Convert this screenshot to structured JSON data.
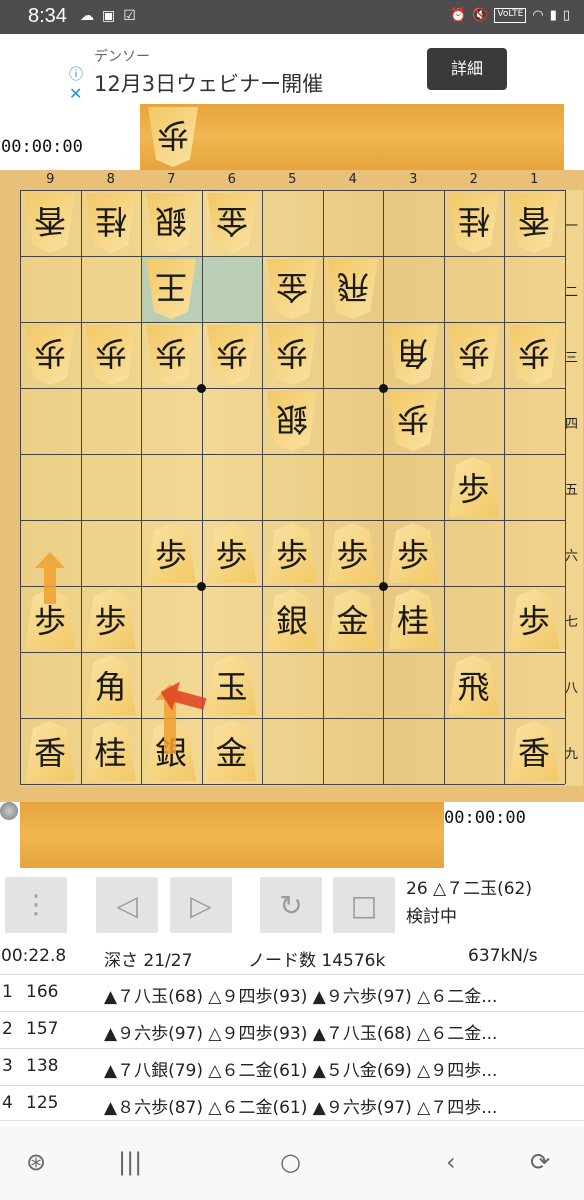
{
  "status_bar": {
    "time": "8:34",
    "left_icons": [
      "cloud-icon",
      "image-icon",
      "check-icon"
    ],
    "right_icons": [
      "alarm-icon",
      "mute-icon",
      "volte-icon",
      "wifi-icon",
      "signal-icon",
      "battery-icon"
    ],
    "volte": "VoLTE"
  },
  "ad": {
    "brand": "デンソー",
    "message": "12月3日ウェビナー開催",
    "cta": "詳細"
  },
  "clocks": {
    "gote": "00:00:00",
    "sente": "00:00:00"
  },
  "gote_hand": [
    "歩"
  ],
  "board": {
    "columns": [
      "9",
      "8",
      "7",
      "6",
      "5",
      "4",
      "3",
      "2",
      "1"
    ],
    "rows": [
      "一",
      "二",
      "三",
      "四",
      "五",
      "六",
      "七",
      "八",
      "九"
    ],
    "pieces": [
      {
        "c": 0,
        "r": 0,
        "k": "香",
        "g": true
      },
      {
        "c": 1,
        "r": 0,
        "k": "桂",
        "g": true
      },
      {
        "c": 2,
        "r": 0,
        "k": "銀",
        "g": true
      },
      {
        "c": 3,
        "r": 0,
        "k": "金",
        "g": true
      },
      {
        "c": 7,
        "r": 0,
        "k": "桂",
        "g": true
      },
      {
        "c": 8,
        "r": 0,
        "k": "香",
        "g": true
      },
      {
        "c": 2,
        "r": 1,
        "k": "王",
        "g": true
      },
      {
        "c": 4,
        "r": 1,
        "k": "金",
        "g": true
      },
      {
        "c": 5,
        "r": 1,
        "k": "飛",
        "g": true
      },
      {
        "c": 0,
        "r": 2,
        "k": "歩",
        "g": true
      },
      {
        "c": 1,
        "r": 2,
        "k": "歩",
        "g": true
      },
      {
        "c": 2,
        "r": 2,
        "k": "歩",
        "g": true
      },
      {
        "c": 3,
        "r": 2,
        "k": "歩",
        "g": true
      },
      {
        "c": 4,
        "r": 2,
        "k": "歩",
        "g": true
      },
      {
        "c": 6,
        "r": 2,
        "k": "角",
        "g": true
      },
      {
        "c": 7,
        "r": 2,
        "k": "歩",
        "g": true
      },
      {
        "c": 8,
        "r": 2,
        "k": "歩",
        "g": true
      },
      {
        "c": 4,
        "r": 3,
        "k": "銀",
        "g": true
      },
      {
        "c": 6,
        "r": 3,
        "k": "歩",
        "g": true
      },
      {
        "c": 7,
        "r": 4,
        "k": "歩",
        "g": false
      },
      {
        "c": 2,
        "r": 5,
        "k": "歩",
        "g": false
      },
      {
        "c": 3,
        "r": 5,
        "k": "歩",
        "g": false
      },
      {
        "c": 4,
        "r": 5,
        "k": "歩",
        "g": false
      },
      {
        "c": 5,
        "r": 5,
        "k": "歩",
        "g": false
      },
      {
        "c": 6,
        "r": 5,
        "k": "歩",
        "g": false
      },
      {
        "c": 0,
        "r": 6,
        "k": "歩",
        "g": false
      },
      {
        "c": 1,
        "r": 6,
        "k": "歩",
        "g": false
      },
      {
        "c": 4,
        "r": 6,
        "k": "銀",
        "g": false
      },
      {
        "c": 5,
        "r": 6,
        "k": "金",
        "g": false
      },
      {
        "c": 6,
        "r": 6,
        "k": "桂",
        "g": false
      },
      {
        "c": 8,
        "r": 6,
        "k": "歩",
        "g": false
      },
      {
        "c": 1,
        "r": 7,
        "k": "角",
        "g": false
      },
      {
        "c": 3,
        "r": 7,
        "k": "玉",
        "g": false
      },
      {
        "c": 7,
        "r": 7,
        "k": "飛",
        "g": false
      },
      {
        "c": 0,
        "r": 8,
        "k": "香",
        "g": false
      },
      {
        "c": 1,
        "r": 8,
        "k": "桂",
        "g": false
      },
      {
        "c": 2,
        "r": 8,
        "k": "銀",
        "g": false
      },
      {
        "c": 3,
        "r": 8,
        "k": "金",
        "g": false
      },
      {
        "c": 8,
        "r": 8,
        "k": "香",
        "g": false
      }
    ],
    "highlight": [
      {
        "c": 2,
        "r": 1
      },
      {
        "c": 3,
        "r": 1
      }
    ]
  },
  "last_move": "26 △７二玉(62)",
  "mode": "検討中",
  "engine": {
    "time": "00:22.8",
    "depth": "深さ  21/27",
    "nodes": "ノード数  14576k",
    "nps": "637kN/s"
  },
  "pv": [
    {
      "n": "1",
      "score": "166",
      "moves": "▲７八玉(68) △９四歩(93) ▲９六歩(97) △６二金..."
    },
    {
      "n": "2",
      "score": "157",
      "moves": "▲９六歩(97) △９四歩(93) ▲７八玉(68) △６二金..."
    },
    {
      "n": "3",
      "score": "138",
      "moves": "▲７八銀(79) △６二金(61) ▲５八金(69) △９四歩..."
    },
    {
      "n": "4",
      "score": "125",
      "moves": "▲８六歩(87) △６二金(61) ▲９六歩(97) △７四歩..."
    }
  ],
  "colors": {
    "board": "#f0d28c",
    "hand": "#f0b752",
    "arrow_best": "#f0a030",
    "arrow_alt": "#e04020"
  }
}
